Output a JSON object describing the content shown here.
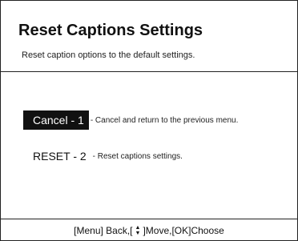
{
  "dialog": {
    "title": "Reset Captions Settings",
    "subtitle": "Reset caption options to the default settings."
  },
  "options": [
    {
      "label": "Cancel - 1",
      "description": "- Cancel and return to the previous menu.",
      "selected": true
    },
    {
      "label": "RESET - 2",
      "description": "- Reset captions settings.",
      "selected": false
    }
  ],
  "footer": {
    "back": "[Menu] Back,[",
    "up_icon": "up-arrow-icon",
    "down_icon": "down-arrow-icon",
    "move_choose": "]Move,[OK]Choose"
  },
  "colors": {
    "selected_bg": "#111111",
    "selected_text": "#ffffff",
    "border": "#222222"
  }
}
